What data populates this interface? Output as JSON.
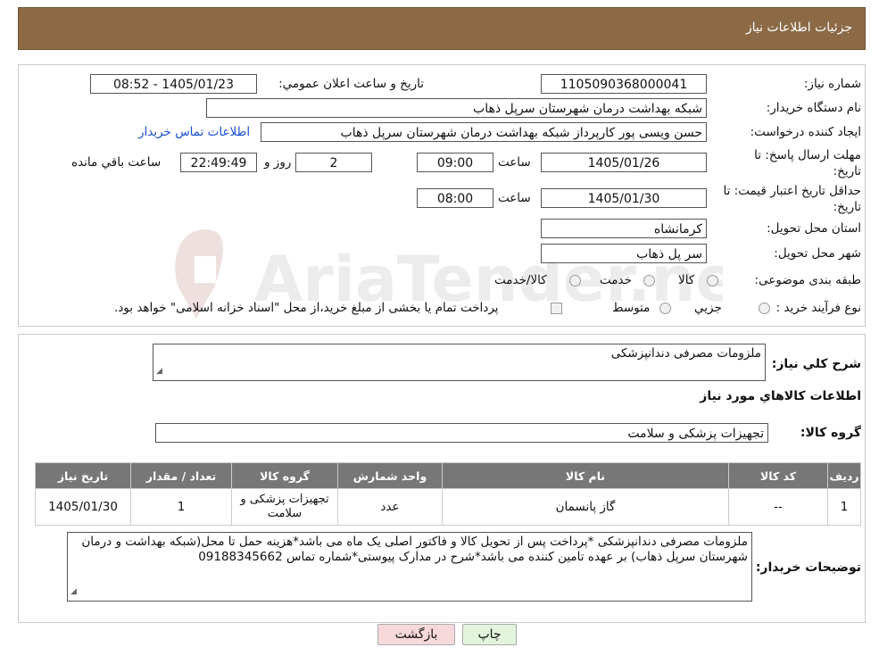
{
  "header": {
    "title": "جزئیات اطلاعات نیاز"
  },
  "form": {
    "need_number": {
      "label": "شماره نیاز:",
      "value": "1105090368000041"
    },
    "announce": {
      "label": "تاریخ و ساعت اعلان عمومي:",
      "value": "1405/01/23 - 08:52"
    },
    "buyer": {
      "label": "نام دستگاه خریدار:",
      "value": "شبکه بهداشت درمان شهرستان سرپل ذهاب"
    },
    "requester": {
      "label": "ایجاد کننده درخواست:",
      "value": "حسن ویسی پور کارپرداز شبکه بهداشت درمان شهرستان سرپل ذهاب",
      "contact_link": "اطلاعات تماس خریدار"
    },
    "deadline": {
      "label": "مهلت ارسال پاسخ: تا تاریخ:",
      "date": "1405/01/26",
      "time_label": "ساعت",
      "time": "09:00",
      "days": "2",
      "days_label": "روز و",
      "remaining": "22:49:49",
      "remaining_label": "ساعت باقي مانده"
    },
    "validity": {
      "label": "حداقل تاریخ اعتبار قیمت: تا تاریخ:",
      "date": "1405/01/30",
      "time_label": "ساعت",
      "time": "08:00"
    },
    "province": {
      "label": "استان محل تحویل:",
      "value": "کرمانشاه"
    },
    "city": {
      "label": "شهر محل تحویل:",
      "value": "سر پل ذهاب"
    },
    "category": {
      "label": "طبقه بندی موضوعی:",
      "options": [
        "کالا",
        "خدمت",
        "کالا/خدمت"
      ]
    },
    "process": {
      "label": "نوع فرآیند خرید :",
      "options": [
        "جزيي",
        "متوسط"
      ],
      "note": "پرداخت تمام یا بخشی از مبلغ خرید،از محل \"اسناد خزانه اسلامی\" خواهد بود."
    }
  },
  "summary": {
    "label": "شرح کلي نیاز:",
    "value": "ملزومات مصرفی دندانپزشکی",
    "goods_info_title": "اطلاعات کالاهاي مورد نیاز",
    "group_label": "گروه کالا:",
    "group_value": "تجهیزات پزشکی و سلامت"
  },
  "table": {
    "headers": [
      "ردیف",
      "کد کالا",
      "نام کالا",
      "واحد شمارش",
      "گروه کالا",
      "تعداد / مقدار",
      "تاریخ نیاز"
    ],
    "rows": [
      {
        "row": "1",
        "code": "--",
        "name": "گاز پانسمان",
        "unit": "عدد",
        "group": "تجهیزات پزشکی و سلامت",
        "qty": "1",
        "date": "1405/01/30"
      }
    ]
  },
  "buyer_notes": {
    "label": "توضیحات خریدار:",
    "value": "ملزومات مصرفی دندانپزشکی *پرداخت پس از تحویل کالا و فاکتور اصلی یک ماه می باشد*هزینه حمل تا محل(شبکه بهداشت و درمان شهرستان سرپل ذهاب) بر عهده تامین کننده می باشد*شرح در مدارک پیوستی*شماره تماس 09188345662"
  },
  "buttons": {
    "print": "چاپ",
    "back": "بازگشت"
  },
  "colors": {
    "header_bg": "#8b6a45",
    "table_header_bg": "#777777",
    "link": "#1a4fd1",
    "back_button_bg": "#f7d9dc",
    "print_button_bg": "#e2f5dc"
  }
}
